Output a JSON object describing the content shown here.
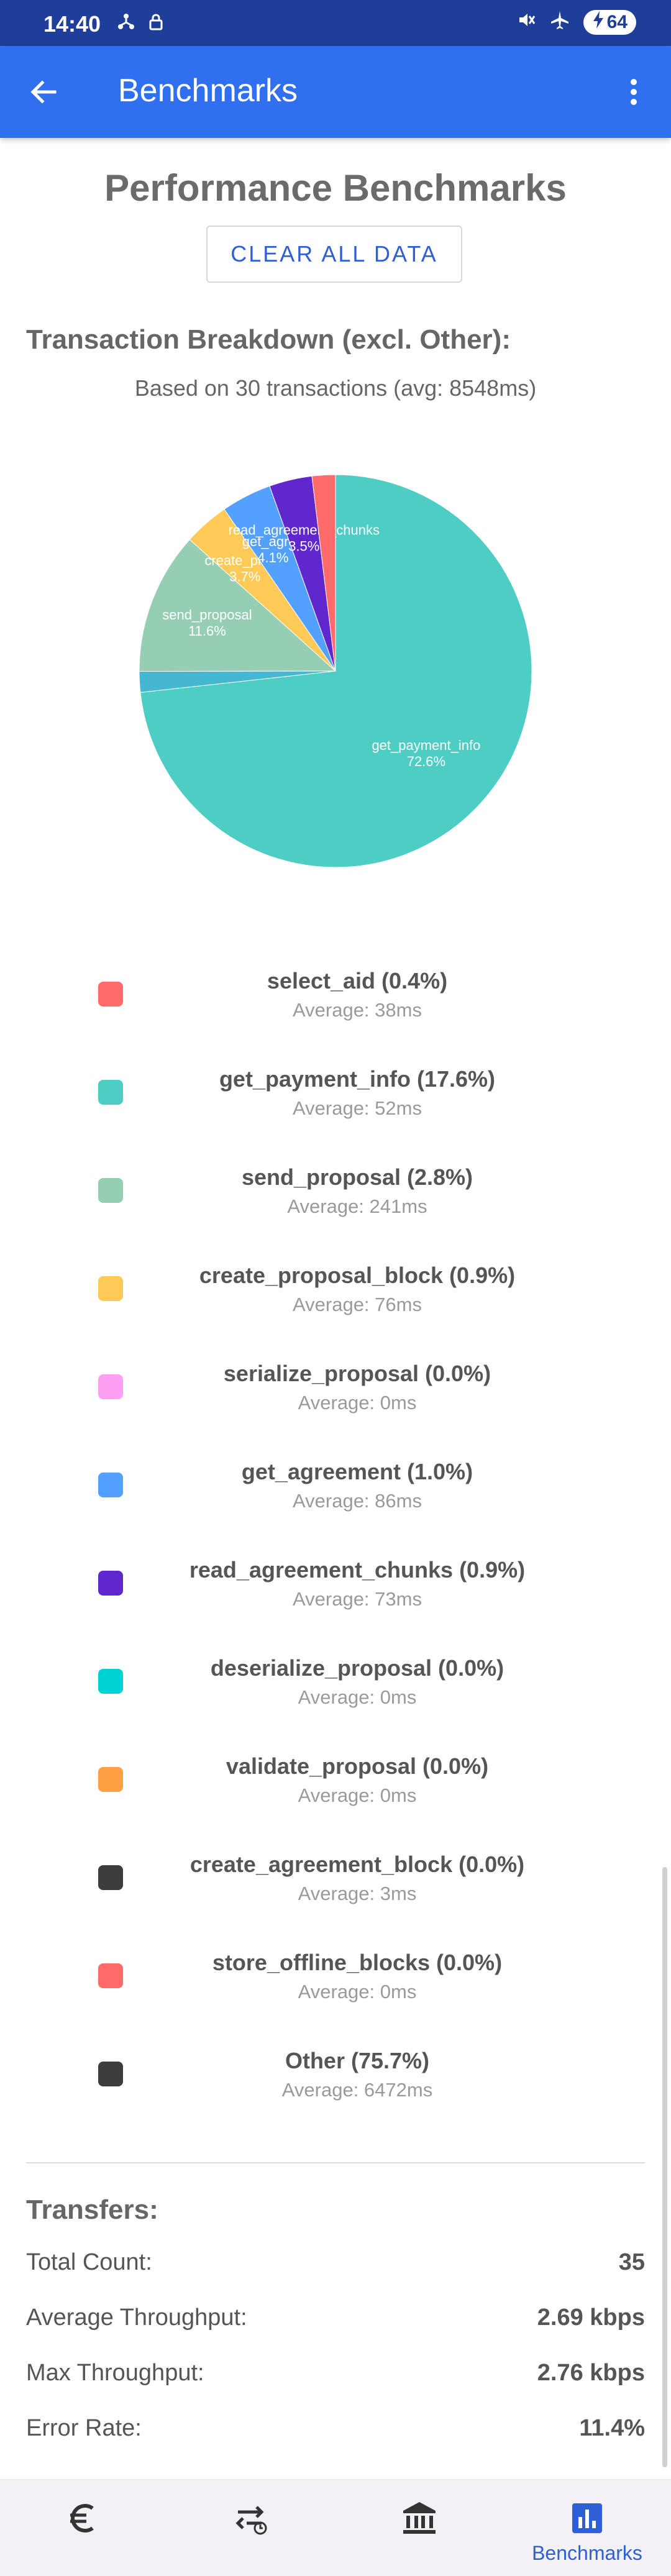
{
  "status_bar": {
    "time": "14:40",
    "battery": "64",
    "icons": [
      "nearby-share-icon",
      "lock-icon",
      "mute-icon",
      "airplane-icon",
      "battery-charging-icon"
    ]
  },
  "app_bar": {
    "title": "Benchmarks",
    "icons": [
      "arrow-back-icon",
      "more-vert-icon"
    ]
  },
  "page": {
    "title": "Performance Benchmarks",
    "clear_button": "CLEAR ALL DATA",
    "breakdown_heading": "Transaction Breakdown (excl. Other):",
    "based_on": "Based on 30 transactions (avg: 8548ms)"
  },
  "chart_data": {
    "type": "pie",
    "title": "",
    "slices": [
      {
        "label": "get_payment_info",
        "value": 72.6,
        "display": "72.6%",
        "color": "#4ecdc4"
      },
      {
        "label": "",
        "value": 1.7,
        "display": "",
        "color": "#45b7d1"
      },
      {
        "label": "send_proposal",
        "value": 11.6,
        "display": "11.6%",
        "color": "#96ceb4"
      },
      {
        "label": "create_proposal_block",
        "short_label": "create_propo",
        "value": 3.7,
        "display": "3.7%",
        "color": "#feca57"
      },
      {
        "label": "get_agreement",
        "short_label": "get_agree",
        "value": 4.1,
        "display": "4.1%",
        "color": "#54a0ff"
      },
      {
        "label": "read_agreement_chunks",
        "value": 3.5,
        "display": "3.5%",
        "color": "#5f27cd"
      },
      {
        "label": "",
        "value": 1.9,
        "display": "",
        "color": "#ff6b6b"
      }
    ]
  },
  "legend": [
    {
      "name": "select_aid (0.4%)",
      "avg": "Average: 38ms",
      "color": "#ff6b6b"
    },
    {
      "name": "get_payment_info (17.6%)",
      "avg": "Average: 52ms",
      "color": "#4ecdc4"
    },
    {
      "name": "send_proposal (2.8%)",
      "avg": "Average: 241ms",
      "color": "#96ceb4"
    },
    {
      "name": "create_proposal_block (0.9%)",
      "avg": "Average: 76ms",
      "color": "#feca57"
    },
    {
      "name": "serialize_proposal (0.0%)",
      "avg": "Average: 0ms",
      "color": "#ff9ff3"
    },
    {
      "name": "get_agreement (1.0%)",
      "avg": "Average: 86ms",
      "color": "#54a0ff"
    },
    {
      "name": "read_agreement_chunks (0.9%)",
      "avg": "Average: 73ms",
      "color": "#5f27cd"
    },
    {
      "name": "deserialize_proposal (0.0%)",
      "avg": "Average: 0ms",
      "color": "#00d2d3"
    },
    {
      "name": "validate_proposal (0.0%)",
      "avg": "Average: 0ms",
      "color": "#ff9f43"
    },
    {
      "name": "create_agreement_block (0.0%)",
      "avg": "Average: 3ms",
      "color": "#3d3d3d"
    },
    {
      "name": "store_offline_blocks (0.0%)",
      "avg": "Average: 0ms",
      "color": "#ff6b6b"
    },
    {
      "name": "Other (75.7%)",
      "avg": "Average: 6472ms",
      "color": "#3d3d3d"
    }
  ],
  "transfers": {
    "heading": "Transfers:",
    "rows": [
      {
        "label": "Total Count:",
        "value": "35"
      },
      {
        "label": "Average Throughput:",
        "value": "2.69 kbps"
      },
      {
        "label": "Max Throughput:",
        "value": "2.76 kbps"
      },
      {
        "label": "Error Rate:",
        "value": "11.4%"
      }
    ]
  },
  "bottom_nav": {
    "items": [
      {
        "icon": "euro-icon",
        "label": ""
      },
      {
        "icon": "transfer-history-icon",
        "label": ""
      },
      {
        "icon": "bank-icon",
        "label": ""
      },
      {
        "icon": "bar-chart-icon",
        "label": "Benchmarks"
      }
    ],
    "accent": "#2f5fd6"
  }
}
